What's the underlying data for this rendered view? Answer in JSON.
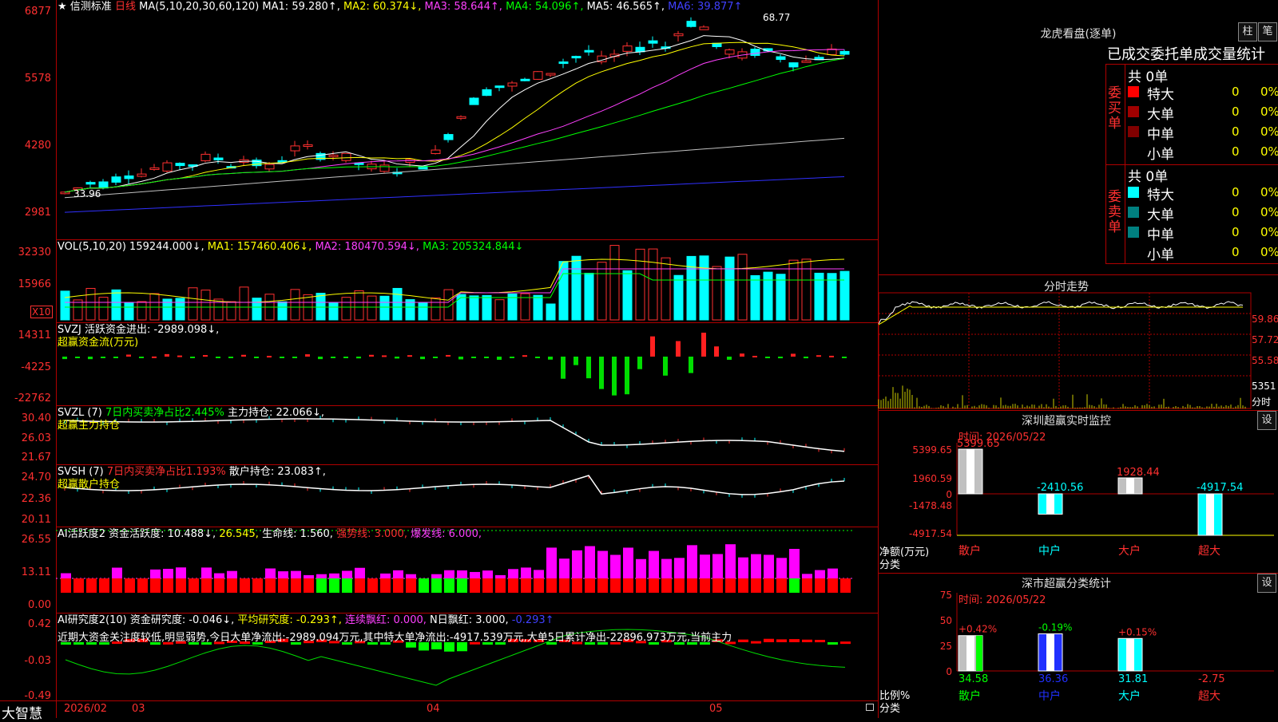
{
  "window": {
    "app_name": "大智慧",
    "date_labels": [
      "2026/02",
      "03",
      "04",
      "05"
    ]
  },
  "main": {
    "header": {
      "star": "★",
      "title": "信测标准",
      "period": "日线",
      "ma_label": "MA(5,10,20,30,60,120)",
      "ma1": "MA1: 59.280↑,",
      "ma2": "MA2: 60.374↓,",
      "ma3": "MA3: 58.644↑,",
      "ma4": "MA4: 54.096↑,",
      "ma5": "MA5: 46.565↑,",
      "ma6": "MA6: 39.877↑"
    },
    "ticks": [
      "6877",
      "5578",
      "4280",
      "2981"
    ],
    "high_label": "68.77",
    "low_label": "33.96"
  },
  "vol": {
    "header": {
      "label": "VOL(5,10,20)",
      "value": "159244.000↓,",
      "ma1": "MA1: 157460.406↓,",
      "ma2": "MA2: 180470.594↓,",
      "ma3": "MA3: 205324.844↓"
    },
    "ticks": [
      "32330",
      "15966"
    ],
    "unit": "X10"
  },
  "svzj": {
    "header": {
      "label": "SVZJ",
      "desc": "活跃资金进出: -2989.098↓,",
      "sub": "超赢资金流(万元)"
    },
    "ticks": [
      "14311",
      "-4225",
      "-22762"
    ]
  },
  "svzl": {
    "header": {
      "label": "SVZL (7)",
      "desc": "7日内买卖净占比2.445%",
      "hold": "主力持仓: 22.066↓,",
      "sub": "超赢主力持仓"
    },
    "ticks": [
      "30.40",
      "26.03",
      "21.67"
    ]
  },
  "svsh": {
    "header": {
      "label": "SVSH (7)",
      "desc": "7日内买卖净占比1.193%",
      "hold": "散户持仓: 23.083↑,",
      "sub": "超赢散户持仓"
    },
    "ticks": [
      "24.70",
      "22.36",
      "20.11"
    ]
  },
  "ai1": {
    "header": {
      "label": "AI活跃度2",
      "a": "资金活跃度: 10.488↓,",
      "b": "26.545,",
      "c": "生命线: 1.560,",
      "d": "强势线: 3.000,",
      "e": "爆发线: 6.000,"
    },
    "ticks": [
      "26.55",
      "13.11",
      "0.00"
    ]
  },
  "ai2": {
    "header": {
      "label": "AI研究度2(10)",
      "a": "资金研究度: -0.046↓,",
      "b": "平均研究度: -0.293↑,",
      "c": "连续飘红: 0.000,",
      "d": "N日飘红: 3.000,",
      "e": "-0.293↑"
    },
    "note": "近期大资金关注度较低,明显弱势,今日大单净流出:-2989.094万元,其中特大单净流出:-4917.539万元,大单5日累计净出-22896.973万元,当前主力",
    "ticks": [
      "0.42",
      "-0.03",
      "-0.49"
    ]
  },
  "lhb": {
    "title": "龙虎看盘(逐单)",
    "btn_zhu": "柱",
    "btn_bi": "笔",
    "tabs": "已成交委托单成交量统计",
    "buy": {
      "side": "委买单",
      "total": "共 0单",
      "rows": [
        {
          "name": "特大",
          "count": "0",
          "pct": "0%",
          "color": "#ff0000"
        },
        {
          "name": "大单",
          "count": "0",
          "pct": "0%",
          "color": "#a00000"
        },
        {
          "name": "中单",
          "count": "0",
          "pct": "0%",
          "color": "#800000"
        },
        {
          "name": "小单",
          "count": "0",
          "pct": "0%",
          "color": "#000000"
        }
      ]
    },
    "sell": {
      "side": "委卖单",
      "total": "共 0单",
      "rows": [
        {
          "name": "特大",
          "count": "0",
          "pct": "0%",
          "color": "#00ffff"
        },
        {
          "name": "大单",
          "count": "0",
          "pct": "0%",
          "color": "#008080"
        },
        {
          "name": "中单",
          "count": "0",
          "pct": "0%",
          "color": "#008080"
        },
        {
          "name": "小单",
          "count": "0",
          "pct": "0%",
          "color": "#000000"
        }
      ]
    }
  },
  "intraday": {
    "title": "分时走势",
    "ticks": [
      "59.86",
      "57.72",
      "55.58"
    ],
    "vol_tick": "5351",
    "vol_label": "分时"
  },
  "sz_monitor": {
    "title": "深圳超赢实时监控",
    "btn": "设",
    "time": "时间: 2026/05/22",
    "ticks": [
      "5399.65",
      "1960.59",
      "0",
      "-1478.48",
      "-4917.54"
    ],
    "y_label": "净额(万元)",
    "x_label": "分类",
    "bars": [
      {
        "cat": "散户",
        "value": 5399.65,
        "label": "5399.65"
      },
      {
        "cat": "中户",
        "value": -2410.56,
        "label": "-2410.56"
      },
      {
        "cat": "大户",
        "value": 1928.44,
        "label": "1928.44"
      },
      {
        "cat": "超大",
        "value": -4917.54,
        "label": "-4917.54"
      }
    ]
  },
  "sz_stats": {
    "title": "深市超赢分类统计",
    "btn": "设",
    "time": "时间: 2026/05/22",
    "ticks": [
      "75",
      "50",
      "25",
      "0"
    ],
    "y_label": "比例%",
    "x_label": "分类",
    "bars": [
      {
        "cat": "散户",
        "value": 34.58,
        "label": "34.58",
        "delta": "+0.42%"
      },
      {
        "cat": "中户",
        "value": 36.36,
        "label": "36.36",
        "delta": "-0.19%"
      },
      {
        "cat": "大户",
        "value": 31.81,
        "label": "31.81",
        "delta": "+0.15%"
      },
      {
        "cat": "超大",
        "value": -2.75,
        "label": "-2.75",
        "delta": ""
      }
    ]
  },
  "colors": {
    "up": "#ff3030",
    "down": "#00ffff",
    "grid": "#b00000"
  }
}
